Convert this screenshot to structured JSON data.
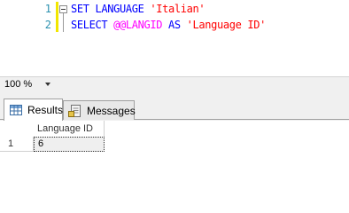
{
  "editor": {
    "lines": [
      {
        "number": "1",
        "kw1": "SET LANGUAGE",
        "str1": "'Italian'"
      },
      {
        "number": "2",
        "kw1": "SELECT",
        "sysvar": "@@LANGID",
        "kw2": "AS",
        "str1": "'Language ID'"
      }
    ]
  },
  "zoom": {
    "value": "100 %"
  },
  "tabs": [
    {
      "label": "Results",
      "icon": "grid-icon",
      "active": true
    },
    {
      "label": "Messages",
      "icon": "messages-icon",
      "active": false
    }
  ],
  "grid": {
    "columns": [
      "Language ID"
    ],
    "rows": [
      {
        "row_number": "1",
        "cells": [
          "6"
        ]
      }
    ]
  },
  "colors": {
    "keyword": "#0000ff",
    "string": "#ff0000",
    "system_variable": "#ff00ff",
    "line_number": "#2b91af",
    "change_marker": "#f2e600"
  }
}
